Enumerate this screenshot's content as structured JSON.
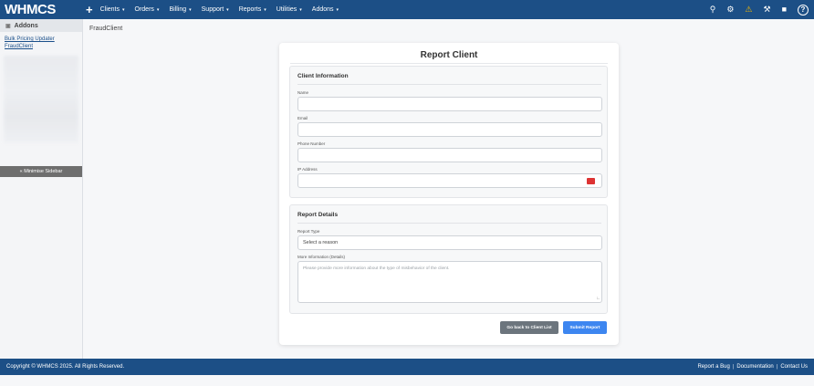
{
  "app": {
    "logo_text": "WHMCS"
  },
  "nav": {
    "plus": "+",
    "items": [
      {
        "label": "Clients"
      },
      {
        "label": "Orders"
      },
      {
        "label": "Billing"
      },
      {
        "label": "Support"
      },
      {
        "label": "Reports"
      },
      {
        "label": "Utilities"
      },
      {
        "label": "Addons"
      }
    ],
    "caret": "▾",
    "right_icons": [
      "search-icon",
      "gears-icon",
      "warning-icon",
      "wrench-icon",
      "user-shield-icon",
      "help-icon"
    ]
  },
  "sidebar": {
    "header": "Addons",
    "links": [
      "Bulk Pricing Updater",
      "FraudClient"
    ],
    "minimise": "« Minimise Sidebar"
  },
  "breadcrumb": "FraudClient",
  "form": {
    "title": "Report Client",
    "client_info": {
      "title": "Client Information",
      "name_label": "Name",
      "email_label": "Email",
      "phone_label": "Phone Number",
      "ip_label": "IP Address"
    },
    "report_details": {
      "title": "Report Details",
      "type_label": "Report Type",
      "type_value": "Select a reason",
      "info_label": "More Information (Details)",
      "info_placeholder": "Please provide more information about the type of misbehavior of the client."
    },
    "buttons": {
      "back": "Go back to Client List",
      "submit": "Submit Report"
    }
  },
  "footer": {
    "copyright": "Copyright © WHMCS 2025. All Rights Reserved.",
    "links": [
      "Report a Bug",
      "Documentation",
      "Contact Us"
    ]
  },
  "colors": {
    "nav_bg": "#1c4f86",
    "submit": "#3d86f0",
    "back": "#6c757d"
  }
}
